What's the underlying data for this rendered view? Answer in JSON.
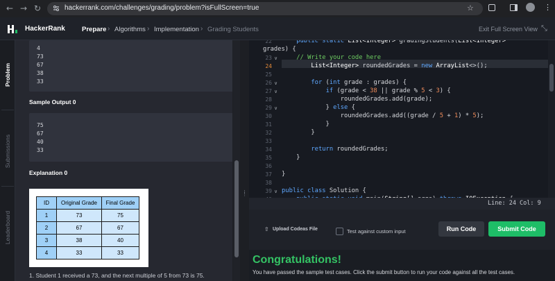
{
  "browser": {
    "back_icon": "arrow-left-icon",
    "forward_icon": "arrow-right-icon",
    "reload_icon": "reload-icon",
    "url": "hackerrank.com/challenges/grading/problem?isFullScreen=true"
  },
  "header": {
    "brand": "HackerRank",
    "breadcrumbs": [
      "Prepare",
      "Algorithms",
      "Implementation",
      "Grading Students"
    ],
    "exit_fullscreen": "Exit Full Screen View"
  },
  "sidebar": {
    "tabs": [
      "Problem",
      "Submissions",
      "Leaderboard"
    ]
  },
  "problem": {
    "sample_input_lines": [
      "4",
      "73",
      "67",
      "38",
      "33"
    ],
    "sample_output_title": "Sample Output 0",
    "sample_output_lines": [
      "75",
      "67",
      "40",
      "33"
    ],
    "explanation_title": "Explanation 0",
    "table": {
      "headers": [
        "ID",
        "Original Grade",
        "Final Grade"
      ],
      "rows": [
        [
          "1",
          "73",
          "75"
        ],
        [
          "2",
          "67",
          "67"
        ],
        [
          "3",
          "38",
          "40"
        ],
        [
          "4",
          "33",
          "33"
        ]
      ]
    },
    "explanation_line_1": "1. Student 1 received a 73, and the next multiple of 5 from 73 is 75."
  },
  "editor": {
    "line_numbers": [
      "22",
      "",
      "23",
      "24",
      "25",
      "26",
      "27",
      "28",
      "29",
      "30",
      "31",
      "32",
      "33",
      "34",
      "35",
      "36",
      "37",
      "38",
      "39",
      "40"
    ],
    "current_line": "24",
    "status": "Line: 24 Col: 9"
  },
  "actions": {
    "upload": "Upload Codeas File",
    "custom_input": "Test against custom input",
    "run": "Run Code",
    "submit": "Submit Code"
  },
  "result": {
    "title": "Congratulations!",
    "message": "You have passed the sample test cases. Click the submit button to run your code against all the test cases."
  },
  "colors": {
    "accent_green": "#1ebd67",
    "congrats_green": "#34c364",
    "keyword_blue": "#5fa8ff",
    "comment_green": "#6fcf63"
  }
}
